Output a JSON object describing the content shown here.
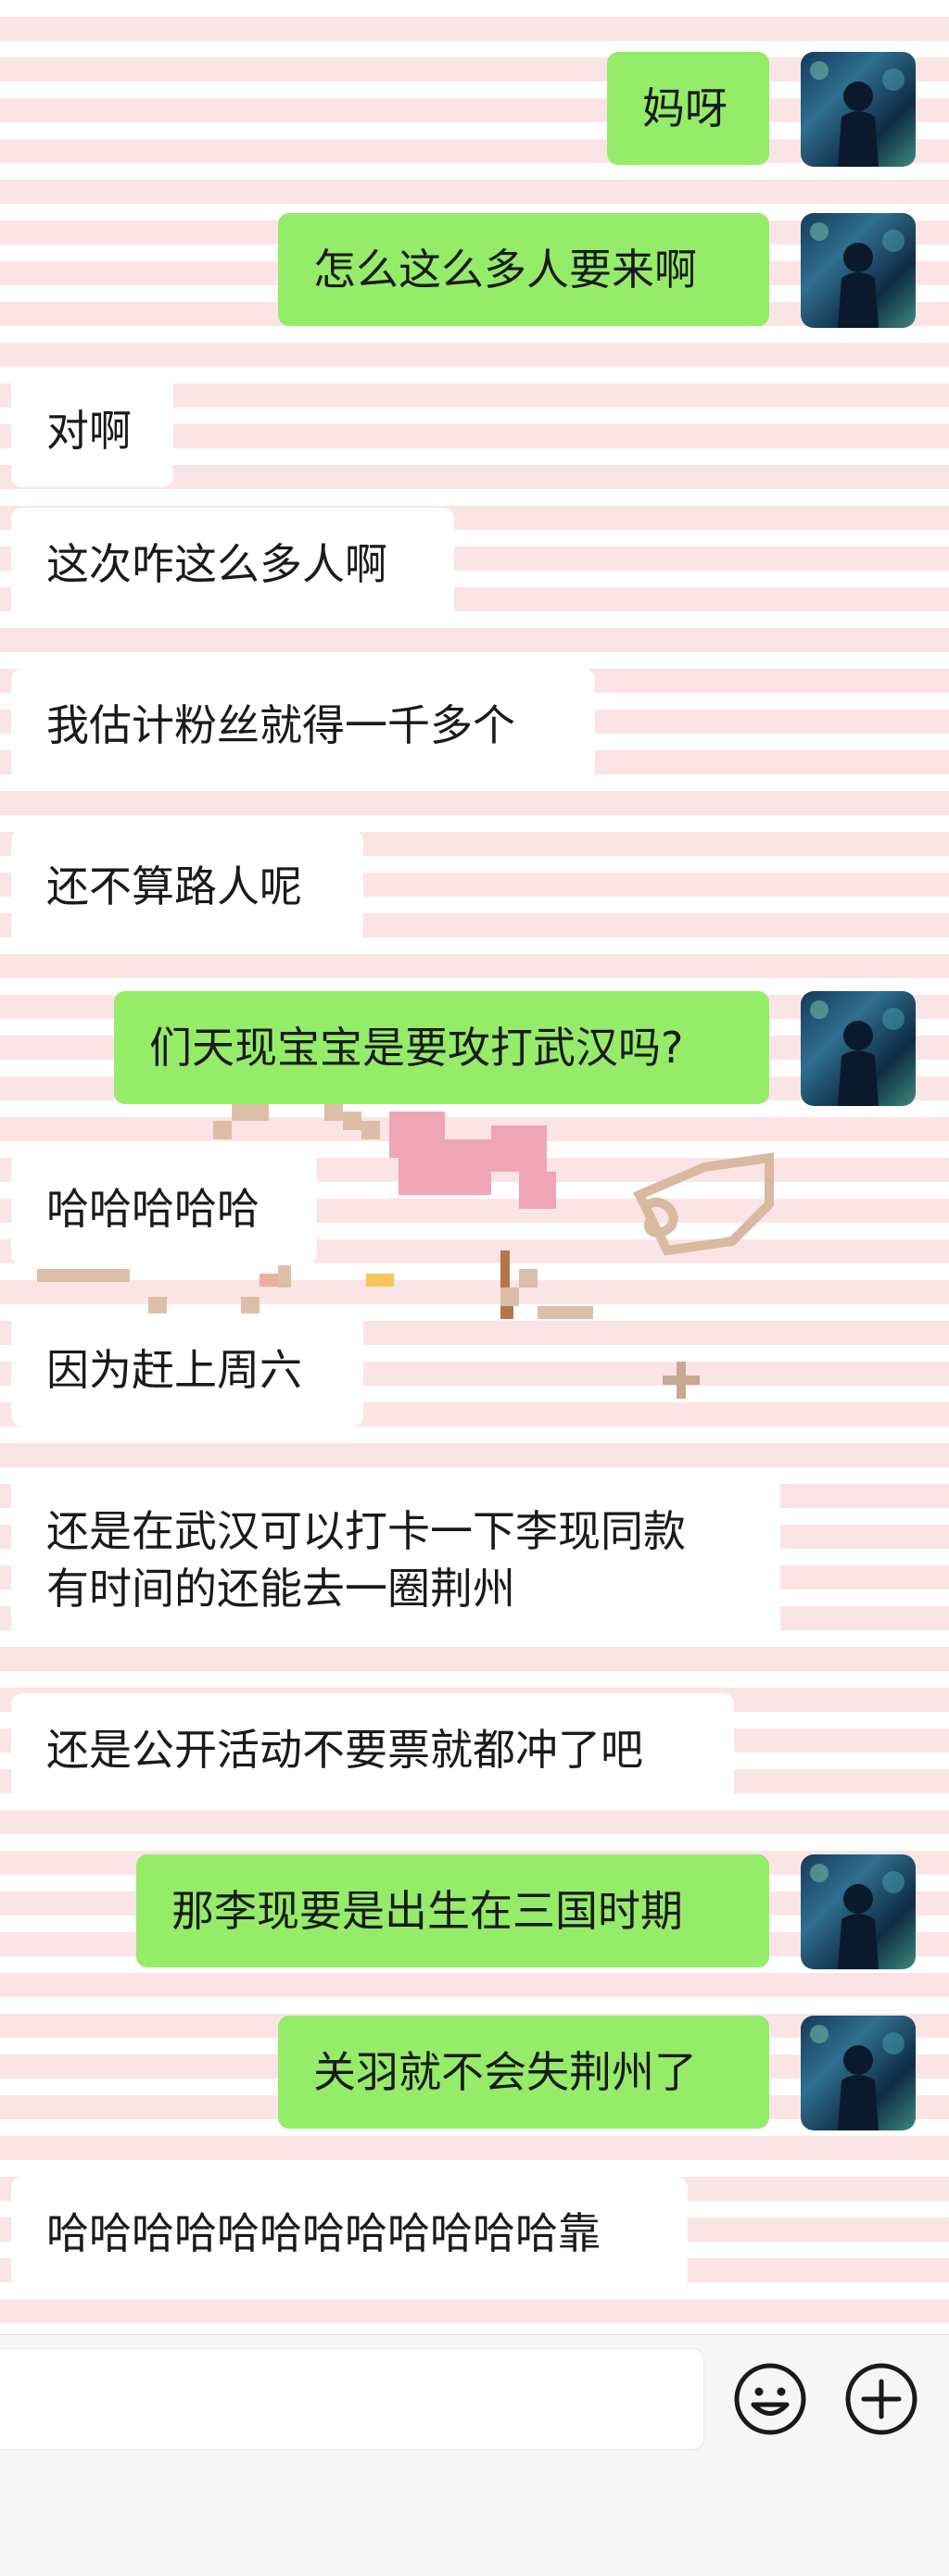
{
  "chat": {
    "messages": [
      {
        "side": "out",
        "text": "妈呀"
      },
      {
        "side": "out",
        "text": "怎么这么多人要来啊"
      },
      {
        "side": "in",
        "text": "对啊"
      },
      {
        "side": "in",
        "text": "这次咋这么多人啊"
      },
      {
        "side": "in",
        "text": "我估计粉丝就得一千多个"
      },
      {
        "side": "in",
        "text": "还不算路人呢"
      },
      {
        "side": "out",
        "text": "们天现宝宝是要攻打武汉吗?"
      },
      {
        "side": "in",
        "text": "哈哈哈哈哈"
      },
      {
        "side": "in",
        "text": "因为赶上周六"
      },
      {
        "side": "in",
        "lines": [
          "还是在武汉可以打卡一下李现同款",
          "有时间的还能去一圈荆州"
        ]
      },
      {
        "side": "in",
        "text": "还是公开活动不要票就都冲了吧"
      },
      {
        "side": "out",
        "text": "那李现要是出生在三国时期"
      },
      {
        "side": "out",
        "text": "关羽就不会失荆州了"
      },
      {
        "side": "in",
        "text": "哈哈哈哈哈哈哈哈哈哈哈哈靠"
      }
    ]
  },
  "input_bar": {
    "emoji_icon": "smiley-face-icon",
    "plus_icon": "plus-circle-icon"
  },
  "colors": {
    "outgoing_bubble": "#95ec69",
    "incoming_bubble": "#ffffff",
    "stripe_pink": "#fbe4e6"
  }
}
